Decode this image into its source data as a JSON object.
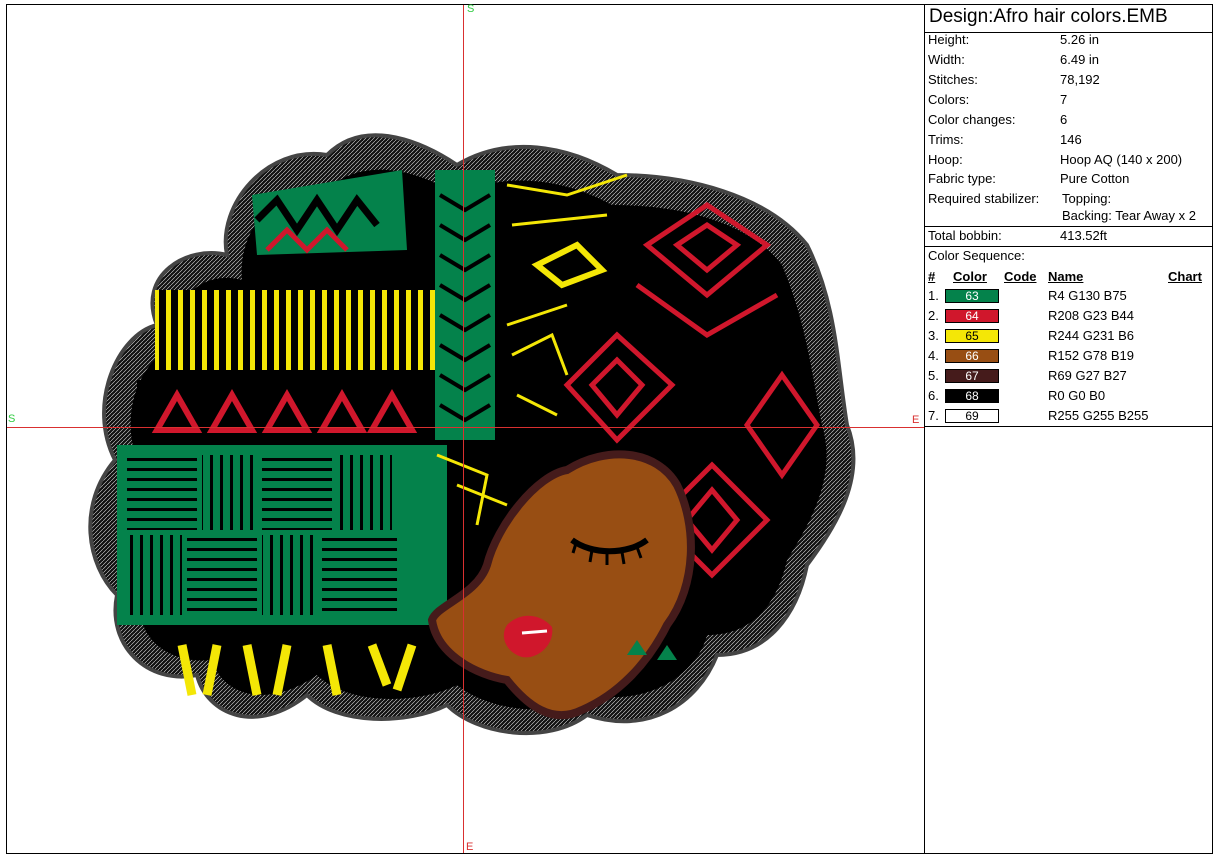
{
  "axes": {
    "top": "S",
    "left": "S",
    "right": "E",
    "bottom": "E"
  },
  "design": {
    "title": "Design:Afro hair colors.EMB",
    "properties": [
      {
        "label": "Height:",
        "value": "5.26 in"
      },
      {
        "label": "Width:",
        "value": "6.49 in"
      },
      {
        "label": "Stitches:",
        "value": "78,192"
      },
      {
        "label": "Colors:",
        "value": "7"
      },
      {
        "label": "Color changes:",
        "value": "6"
      },
      {
        "label": "Trims:",
        "value": "146"
      },
      {
        "label": "Hoop:",
        "value": "Hoop AQ (140 x 200)"
      },
      {
        "label": "Fabric type:",
        "value": "Pure Cotton"
      },
      {
        "label": "Required stabilizer:",
        "value": "Topping:"
      },
      {
        "label": "",
        "value": "Backing: Tear Away x 2"
      },
      {
        "label": "Total bobbin:",
        "value": "413.52ft"
      }
    ]
  },
  "sequence": {
    "heading": "Color Sequence:",
    "headers": {
      "num": "#",
      "color": "Color",
      "code": "Code",
      "name": "Name",
      "chart": "Chart"
    },
    "rows": [
      {
        "num": "1.",
        "code": "63",
        "name": "R4 G130 B75",
        "hex": "#04824b",
        "text": "#ffffff"
      },
      {
        "num": "2.",
        "code": "64",
        "name": "R208 G23 B44",
        "hex": "#d0172c",
        "text": "#ffffff"
      },
      {
        "num": "3.",
        "code": "65",
        "name": "R244 G231 B6",
        "hex": "#f4e706",
        "text": "#000000"
      },
      {
        "num": "4.",
        "code": "66",
        "name": "R152 G78 B19",
        "hex": "#984e13",
        "text": "#ffffff"
      },
      {
        "num": "5.",
        "code": "67",
        "name": "R69 G27 B27",
        "hex": "#451b1b",
        "text": "#ffffff"
      },
      {
        "num": "6.",
        "code": "68",
        "name": "R0 G0 B0",
        "hex": "#000000",
        "text": "#ffffff"
      },
      {
        "num": "7.",
        "code": "69",
        "name": "R255 G255 B255",
        "hex": "#ffffff",
        "text": "#000000"
      }
    ]
  },
  "colors": {
    "crosshair": "#d93030",
    "axis_label": "#2ecc40"
  }
}
